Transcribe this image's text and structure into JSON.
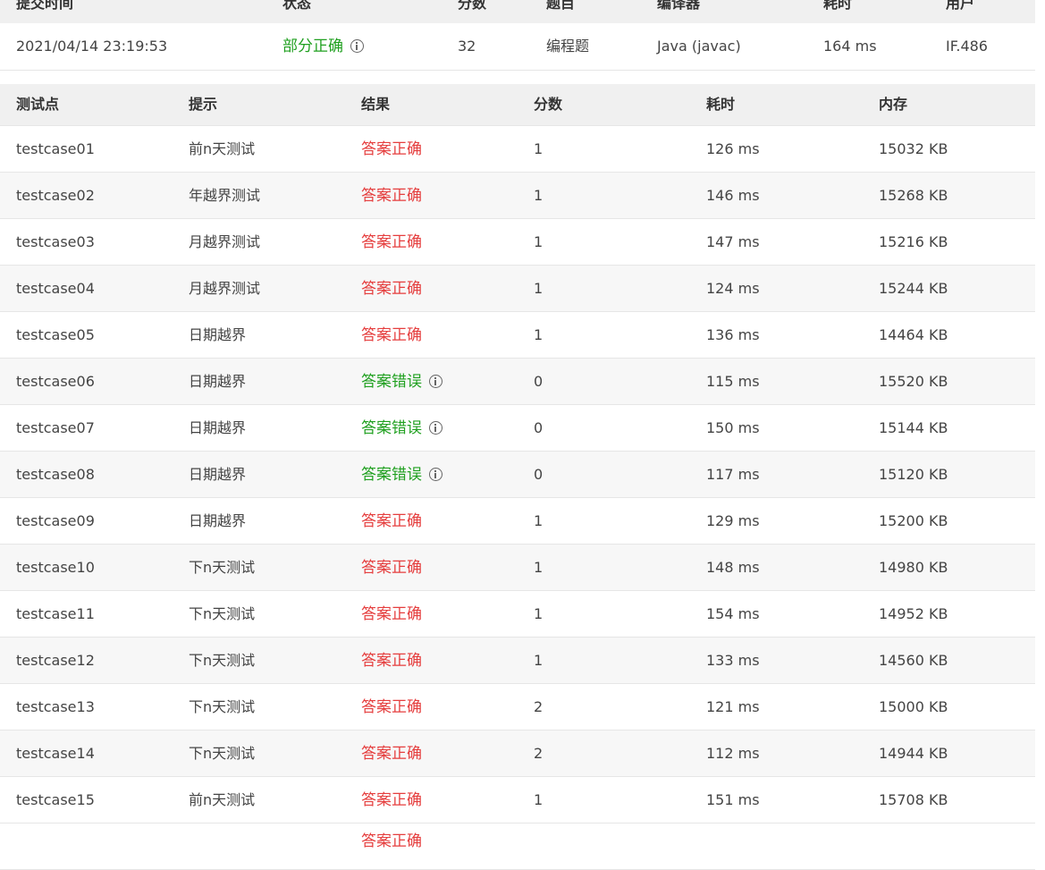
{
  "summary": {
    "headers": [
      "提交时间",
      "状态",
      "分数",
      "题目",
      "编译器",
      "耗时",
      "用户"
    ],
    "row": {
      "time": "2021/04/14 23:19:53",
      "status": "部分正确",
      "score": "32",
      "problem": "编程题",
      "compiler": "Java (javac)",
      "duration": "164 ms",
      "user": "IF.486"
    }
  },
  "testcases": {
    "headers": [
      "测试点",
      "提示",
      "结果",
      "分数",
      "耗时",
      "内存"
    ],
    "rows": [
      {
        "id": "testcase01",
        "hint": "前n天测试",
        "result": "答案正确",
        "score": "1",
        "time": "126 ms",
        "memory": "15032 KB"
      },
      {
        "id": "testcase02",
        "hint": "年越界测试",
        "result": "答案正确",
        "score": "1",
        "time": "146 ms",
        "memory": "15268 KB"
      },
      {
        "id": "testcase03",
        "hint": "月越界测试",
        "result": "答案正确",
        "score": "1",
        "time": "147 ms",
        "memory": "15216 KB"
      },
      {
        "id": "testcase04",
        "hint": "月越界测试",
        "result": "答案正确",
        "score": "1",
        "time": "124 ms",
        "memory": "15244 KB"
      },
      {
        "id": "testcase05",
        "hint": "日期越界",
        "result": "答案正确",
        "score": "1",
        "time": "136 ms",
        "memory": "14464 KB"
      },
      {
        "id": "testcase06",
        "hint": "日期越界",
        "result": "答案错误",
        "score": "0",
        "time": "115 ms",
        "memory": "15520 KB"
      },
      {
        "id": "testcase07",
        "hint": "日期越界",
        "result": "答案错误",
        "score": "0",
        "time": "150 ms",
        "memory": "15144 KB"
      },
      {
        "id": "testcase08",
        "hint": "日期越界",
        "result": "答案错误",
        "score": "0",
        "time": "117 ms",
        "memory": "15120 KB"
      },
      {
        "id": "testcase09",
        "hint": "日期越界",
        "result": "答案正确",
        "score": "1",
        "time": "129 ms",
        "memory": "15200 KB"
      },
      {
        "id": "testcase10",
        "hint": "下n天测试",
        "result": "答案正确",
        "score": "1",
        "time": "148 ms",
        "memory": "14980 KB"
      },
      {
        "id": "testcase11",
        "hint": "下n天测试",
        "result": "答案正确",
        "score": "1",
        "time": "154 ms",
        "memory": "14952 KB"
      },
      {
        "id": "testcase12",
        "hint": "下n天测试",
        "result": "答案正确",
        "score": "1",
        "time": "133 ms",
        "memory": "14560 KB"
      },
      {
        "id": "testcase13",
        "hint": "下n天测试",
        "result": "答案正确",
        "score": "2",
        "time": "121 ms",
        "memory": "15000 KB"
      },
      {
        "id": "testcase14",
        "hint": "下n天测试",
        "result": "答案正确",
        "score": "2",
        "time": "112 ms",
        "memory": "14944 KB"
      },
      {
        "id": "testcase15",
        "hint": "前n天测试",
        "result": "答案正确",
        "score": "1",
        "time": "151 ms",
        "memory": "15708 KB"
      }
    ],
    "partial_next_result": "答案正确"
  },
  "colors": {
    "accepted": "#e53e3e",
    "wrong_answer": "#20a020",
    "partial": "#20a020"
  },
  "icons": {
    "info": "info-circle-icon"
  }
}
